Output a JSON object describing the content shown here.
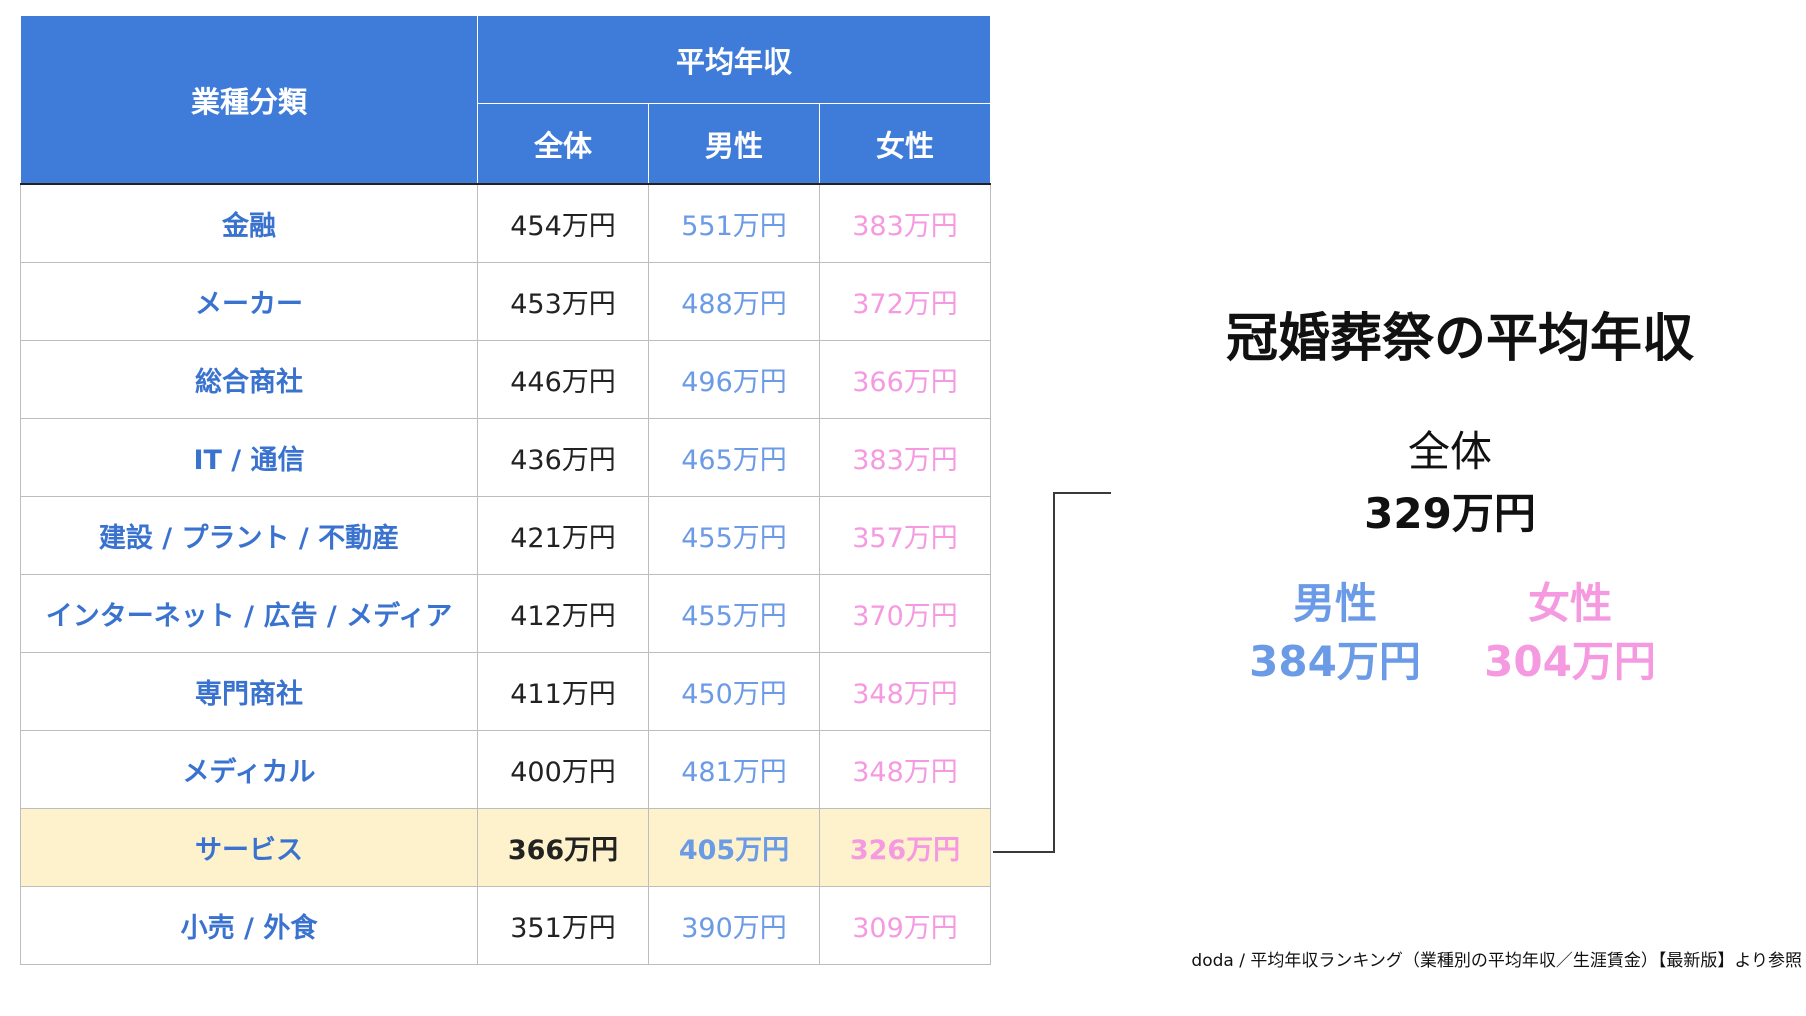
{
  "table": {
    "header_industry": "業種分類",
    "header_group": "平均年収",
    "header_overall": "全体",
    "header_male": "男性",
    "header_female": "女性"
  },
  "chart_data": {
    "type": "table",
    "columns": [
      "業種分類",
      "全体",
      "男性",
      "女性"
    ],
    "rows": [
      {
        "industry": "金融",
        "overall": "454万円",
        "male": "551万円",
        "female": "383万円"
      },
      {
        "industry": "メーカー",
        "overall": "453万円",
        "male": "488万円",
        "female": "372万円"
      },
      {
        "industry": "総合商社",
        "overall": "446万円",
        "male": "496万円",
        "female": "366万円"
      },
      {
        "industry": "IT / 通信",
        "overall": "436万円",
        "male": "465万円",
        "female": "383万円"
      },
      {
        "industry": "建設 / プラント / 不動産",
        "overall": "421万円",
        "male": "455万円",
        "female": "357万円"
      },
      {
        "industry": "インターネット / 広告 / メディア",
        "overall": "412万円",
        "male": "455万円",
        "female": "370万円"
      },
      {
        "industry": "専門商社",
        "overall": "411万円",
        "male": "450万円",
        "female": "348万円"
      },
      {
        "industry": "メディカル",
        "overall": "400万円",
        "male": "481万円",
        "female": "348万円"
      },
      {
        "industry": "サービス",
        "overall": "366万円",
        "male": "405万円",
        "female": "326万円",
        "highlighted": true
      },
      {
        "industry": "小売 / 外食",
        "overall": "351万円",
        "male": "390万円",
        "female": "309万円"
      }
    ]
  },
  "panel": {
    "title": "冠婚葬祭の平均年収",
    "overall_label": "全体",
    "overall_value": "329万円",
    "male_label": "男性",
    "male_value": "384万円",
    "female_label": "女性",
    "female_value": "304万円"
  },
  "source": "doda / 平均年収ランキング（業種別の平均年収／生涯賃金）【最新版】より参照",
  "colors": {
    "header_blue": "#3f7bd8",
    "industry_blue": "#3a73cf",
    "male_blue": "#6b9be6",
    "female_pink": "#f59ae0",
    "highlight_row": "#fdf2cc"
  }
}
